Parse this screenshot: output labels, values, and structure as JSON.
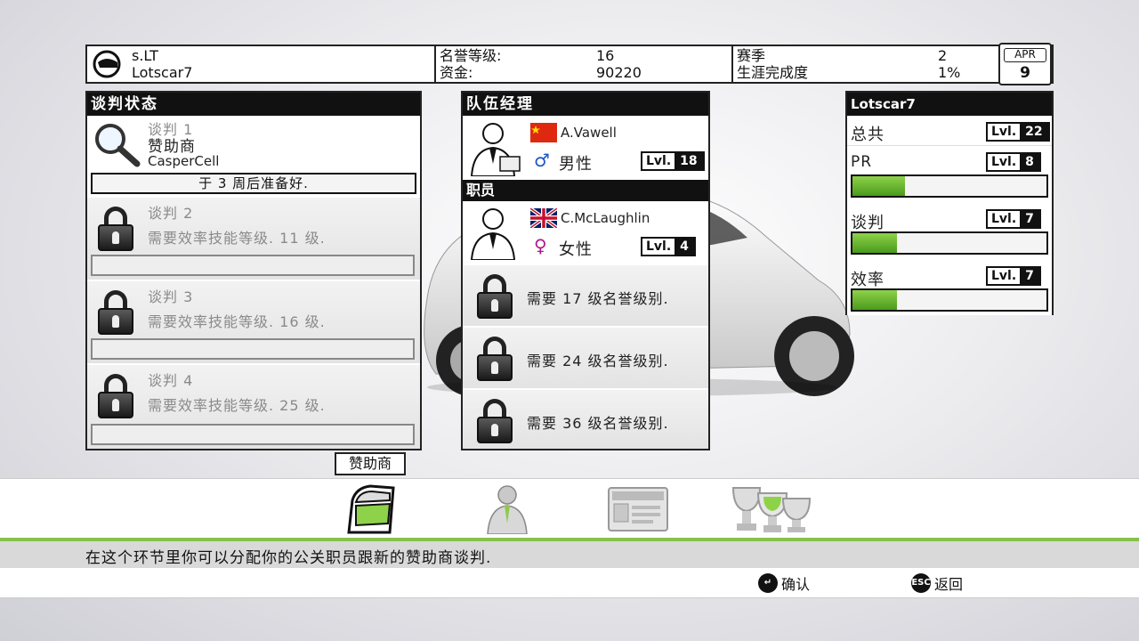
{
  "top_bar": {
    "player_name": "s.LT",
    "team_name": "Lotscar7",
    "prestige_label": "名誉等级:",
    "prestige_value": "16",
    "funds_label": "资金:",
    "funds_value": "90220",
    "season_label": "赛季",
    "season_value": "2",
    "career_label": "生涯完成度",
    "career_value": "1%",
    "calendar_month": "APR",
    "calendar_day": "9"
  },
  "negotiation": {
    "title": "谈判状态",
    "slots": [
      {
        "label": "谈判 1",
        "type": "赞助商",
        "sponsor": "CasperCell",
        "status": "于 3 周后准备好."
      },
      {
        "label": "谈判 2",
        "requirement": "需要效率技能等级. 11 级."
      },
      {
        "label": "谈判 3",
        "requirement": "需要效率技能等级. 16 级."
      },
      {
        "label": "谈判 4",
        "requirement": "需要效率技能等级. 25 级."
      }
    ]
  },
  "team": {
    "manager_title": "队伍经理",
    "manager": {
      "name": "A.Vawell",
      "flag": "china-flag",
      "gender_symbol": "♂",
      "gender": "男性",
      "lvl_label": "Lvl.",
      "lvl": "18"
    },
    "staff_title": "职员",
    "staff": {
      "name": "C.McLaughlin",
      "flag": "uk-flag",
      "gender_symbol": "♀",
      "gender": "女性",
      "lvl_label": "Lvl.",
      "lvl": "4"
    },
    "locked": [
      {
        "requirement": "需要 17 级名誉级别."
      },
      {
        "requirement": "需要 24 级名誉级别."
      },
      {
        "requirement": "需要 36 级名誉级别."
      }
    ]
  },
  "stats": {
    "title": "Lotscar7",
    "rows": [
      {
        "label": "总共",
        "lvl_label": "Lvl.",
        "lvl": "22"
      },
      {
        "label": "PR",
        "lvl_label": "Lvl.",
        "lvl": "8",
        "progress": 0.27
      },
      {
        "label": "谈判",
        "lvl_label": "Lvl.",
        "lvl": "7",
        "progress": 0.23
      },
      {
        "label": "效率",
        "lvl_label": "Lvl.",
        "lvl": "7",
        "progress": 0.23
      }
    ]
  },
  "bottom": {
    "active_tab": "赞助商",
    "tabs": [
      "sponsor-door-icon",
      "staff-person-icon",
      "wrc-card-icon",
      "trophies-icon"
    ],
    "description": "在这个环节里你可以分配你的公关职员跟新的赞助商谈判.",
    "confirm_key": "↵",
    "confirm_label": "确认",
    "back_key": "ESC",
    "back_label": "返回"
  },
  "colors": {
    "accent_green": "#86c14b",
    "panel_border": "#222222"
  }
}
